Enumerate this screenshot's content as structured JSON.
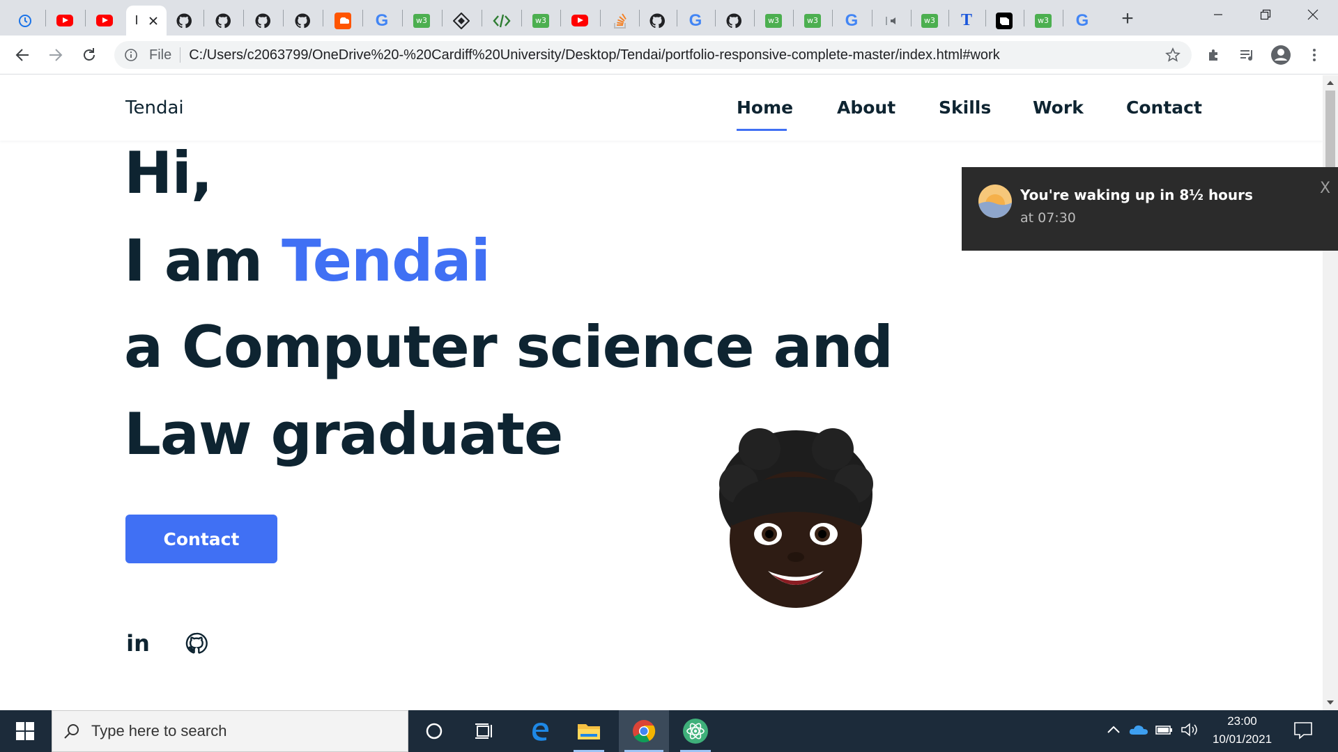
{
  "browser": {
    "tabs": [
      {
        "icon": "history-icon"
      },
      {
        "icon": "youtube-icon"
      },
      {
        "icon": "youtube-icon"
      },
      {
        "icon": "active-tab",
        "label": "I"
      },
      {
        "icon": "github-icon"
      },
      {
        "icon": "github-icon"
      },
      {
        "icon": "github-icon"
      },
      {
        "icon": "github-icon"
      },
      {
        "icon": "soundcloud-icon"
      },
      {
        "icon": "google-icon"
      },
      {
        "icon": "w3schools-icon"
      },
      {
        "icon": "diamond-icon"
      },
      {
        "icon": "code-icon"
      },
      {
        "icon": "w3schools-icon"
      },
      {
        "icon": "youtube-icon"
      },
      {
        "icon": "stackoverflow-icon"
      },
      {
        "icon": "github-icon"
      },
      {
        "icon": "google-icon"
      },
      {
        "icon": "github-icon"
      },
      {
        "icon": "w3schools-icon"
      },
      {
        "icon": "w3schools-icon"
      },
      {
        "icon": "google-icon"
      },
      {
        "icon": "audio-icon"
      },
      {
        "icon": "w3schools-icon"
      },
      {
        "icon": "t-icon"
      },
      {
        "icon": "notion-icon"
      },
      {
        "icon": "w3schools-icon"
      },
      {
        "icon": "google-icon"
      }
    ],
    "w3_label": "w3",
    "g_label": "G",
    "t_label": "T",
    "active_tab_label": "I",
    "omnibox": {
      "scheme_label": "File",
      "url": "C:/Users/c2063799/OneDrive%20-%20Cardiff%20University/Desktop/Tendai/portfolio-responsive-complete-master/index.html#work"
    }
  },
  "site": {
    "logo": "Tendai",
    "nav": [
      "Home",
      "About",
      "Skills",
      "Work",
      "Contact"
    ],
    "active_nav": "Home",
    "hero": {
      "line1": "Hi,",
      "line2_prefix": "I am ",
      "line2_name": "Tendai",
      "line3": "a Computer science and",
      "line4": "Law graduate"
    },
    "contact_button": "Contact",
    "social": {
      "linkedin_label": "in"
    },
    "accent_color": "#4070f4",
    "text_color": "#0e2431"
  },
  "notification": {
    "title": "You're waking up in 8½ hours",
    "subtitle": "at 07:30",
    "close_label": "X"
  },
  "taskbar": {
    "search_placeholder": "Type here to search",
    "time": "23:00",
    "date": "10/01/2021"
  }
}
